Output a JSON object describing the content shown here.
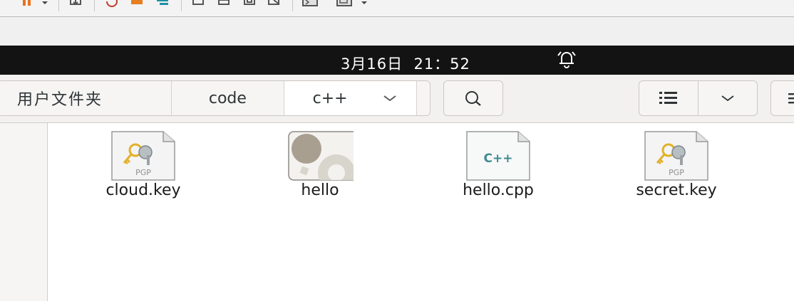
{
  "clock": {
    "date": "3月16日",
    "time": "21：52"
  },
  "path_bar": {
    "home": "用户文件夹",
    "code": "code",
    "current": "c++"
  },
  "files": [
    {
      "name": "cloud.key",
      "icon": "pgp-key-icon"
    },
    {
      "name": "hello",
      "icon": "executable-icon"
    },
    {
      "name": "hello.cpp",
      "icon": "cpp-source-icon"
    },
    {
      "name": "secret.key",
      "icon": "pgp-key-icon"
    }
  ],
  "icon_labels": {
    "pgp": "PGP",
    "cpp": "C++"
  },
  "colors": {
    "top_bar": "#131313",
    "executable_gear": "#a89f90",
    "cpp_accent": "#3f8a92"
  }
}
